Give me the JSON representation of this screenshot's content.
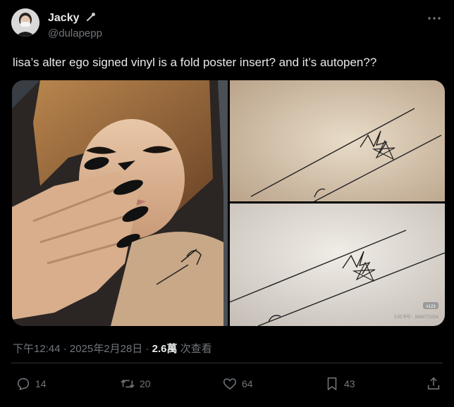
{
  "author": {
    "display_name": "Jacky",
    "handle": "@dulapepp"
  },
  "tweet": {
    "text": "lisa’s alter ego signed vinyl is a fold poster insert? and it’s autopen??"
  },
  "media": {
    "watermark_tag": "#123",
    "watermark_text": "小红书号：5889772254"
  },
  "meta": {
    "time": "下午12:44",
    "sep1": " · ",
    "date": "2025年2月28日",
    "sep2": " · ",
    "views_count": "2.6萬",
    "views_label": " 次查看"
  },
  "actions": {
    "reply_count": "14",
    "repost_count": "20",
    "like_count": "64",
    "bookmark_count": "43"
  },
  "colors": {
    "background": "#000000",
    "primary_text": "#e7e9ea",
    "secondary_text": "#71767b",
    "divider": "#2f3336"
  },
  "icons": [
    "more-icon",
    "pin-icon",
    "reply-icon",
    "repost-icon",
    "like-icon",
    "bookmark-icon",
    "share-icon"
  ]
}
